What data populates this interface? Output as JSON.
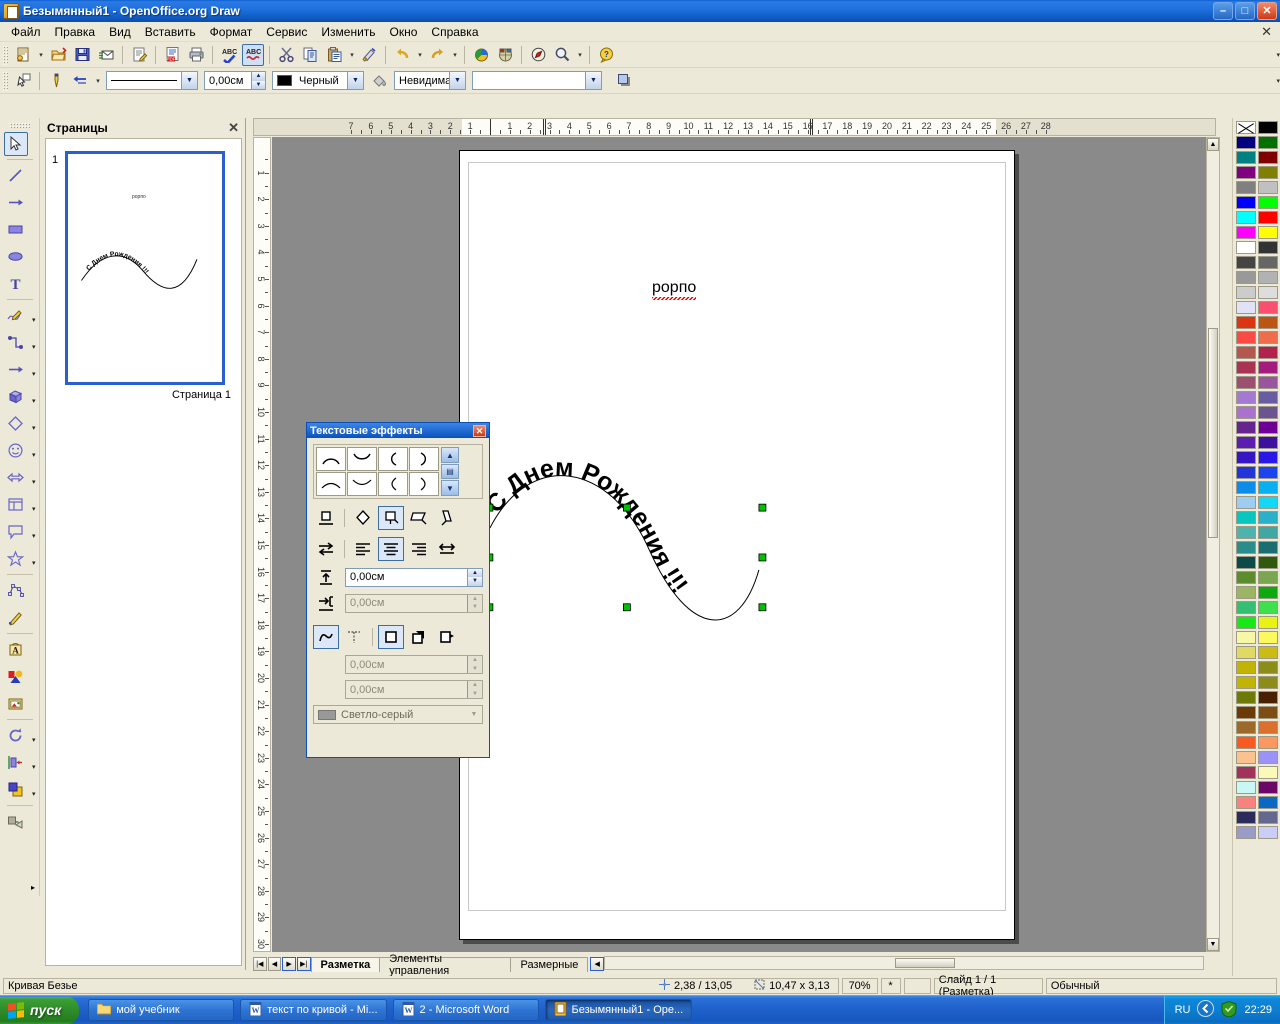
{
  "window": {
    "title": "Безымянный1 - OpenOffice.org Draw",
    "icon": "draw-app-icon",
    "minimize": "–",
    "maximize": "□",
    "close": "✕"
  },
  "menubar": {
    "items": [
      "Файл",
      "Правка",
      "Вид",
      "Вставить",
      "Формат",
      "Сервис",
      "Изменить",
      "Окно",
      "Справка"
    ],
    "doc_close": "✕"
  },
  "toolbar_standard": {
    "items": [
      {
        "name": "new-document-icon",
        "glyph": "📄",
        "dropdown": true
      },
      {
        "name": "open-document-icon",
        "glyph": "📂",
        "dropdown": false
      },
      {
        "name": "save-document-icon",
        "glyph": "💾",
        "dropdown": false
      },
      {
        "name": "send-email-icon",
        "glyph": "✉",
        "dropdown": false
      },
      {
        "name": "edit-file-icon",
        "glyph": "📝",
        "dropdown": false
      },
      {
        "name": "export-pdf-icon",
        "glyph": "📕",
        "dropdown": false
      },
      {
        "name": "print-icon",
        "glyph": "🖨",
        "dropdown": false
      },
      {
        "name": "spellcheck-icon",
        "glyph": "ABC✓",
        "dropdown": false
      },
      {
        "name": "autospellcheck-icon",
        "glyph": "ABC〰",
        "dropdown": false,
        "pressed": true
      },
      {
        "name": "cut-icon",
        "glyph": "✂",
        "dropdown": false
      },
      {
        "name": "copy-icon",
        "glyph": "⧉",
        "dropdown": false
      },
      {
        "name": "paste-icon",
        "glyph": "📋",
        "dropdown": true
      },
      {
        "name": "clone-formatting-icon",
        "glyph": "🖌",
        "dropdown": false
      },
      {
        "name": "undo-icon",
        "glyph": "↶",
        "dropdown": true
      },
      {
        "name": "redo-icon",
        "glyph": "↷",
        "dropdown": true
      },
      {
        "name": "chart-icon",
        "glyph": "◕",
        "dropdown": false
      },
      {
        "name": "gallery-icon",
        "glyph": "🖼",
        "dropdown": false
      },
      {
        "name": "navigator-icon",
        "glyph": "🧭",
        "dropdown": false
      },
      {
        "name": "zoom-icon",
        "glyph": "🔍",
        "dropdown": true
      },
      {
        "name": "help-icon",
        "glyph": "?",
        "dropdown": false
      }
    ],
    "overflow": "▾"
  },
  "toolbar_line_fill": {
    "pointer_icon": "select-pointer-icon",
    "pen_icon": "line-style-pen-icon",
    "arrow_icon": "arrow-style-icon",
    "line_style": {
      "value": "———————",
      "name": "line-style-combo"
    },
    "line_width": {
      "value": "0,00см",
      "name": "line-width-field"
    },
    "line_color": {
      "value": "Черный",
      "swatch": "#000000",
      "name": "line-color-combo"
    },
    "fill_bucket_icon": "fill-bucket-icon",
    "area_style": {
      "value": "Невидимая",
      "name": "area-style-combo"
    },
    "area_fill": {
      "value": "",
      "name": "area-fill-combo"
    },
    "shadow_icon": "shadow-icon",
    "overflow": "▾"
  },
  "left_toolbar": {
    "items": [
      {
        "name": "select-tool",
        "glyph": "select-arrow-icon",
        "selected": true,
        "dropdown": false
      },
      {
        "name": "line-tool",
        "glyph": "line-icon",
        "dropdown": false
      },
      {
        "name": "line-arrow-tool",
        "glyph": "arrow-line-icon",
        "dropdown": false
      },
      {
        "name": "rectangle-tool",
        "glyph": "rectangle-icon",
        "dropdown": false
      },
      {
        "name": "ellipse-tool",
        "glyph": "ellipse-icon",
        "dropdown": false
      },
      {
        "name": "text-tool",
        "glyph": "text-T-icon",
        "dropdown": false
      },
      {
        "name": "curve-tool",
        "glyph": "curve-pencil-icon",
        "dropdown": true
      },
      {
        "name": "connector-tool",
        "glyph": "connector-icon",
        "dropdown": true
      },
      {
        "name": "lines-and-arrows-tool",
        "glyph": "arrow-icon",
        "dropdown": true
      },
      {
        "name": "3d-objects-tool",
        "glyph": "cube-icon",
        "dropdown": true
      },
      {
        "name": "basic-shapes-tool",
        "glyph": "diamond-icon",
        "dropdown": true
      },
      {
        "name": "symbol-shapes-tool",
        "glyph": "smiley-icon",
        "dropdown": true
      },
      {
        "name": "block-arrows-tool",
        "glyph": "block-arrow-icon",
        "dropdown": true
      },
      {
        "name": "flowchart-tool",
        "glyph": "flowchart-icon",
        "dropdown": true
      },
      {
        "name": "callouts-tool",
        "glyph": "callout-icon",
        "dropdown": true
      },
      {
        "name": "stars-tool",
        "glyph": "star-icon",
        "dropdown": true
      },
      {
        "name": "points-tool",
        "glyph": "edit-points-icon",
        "dropdown": false
      },
      {
        "name": "glue-points-tool",
        "glyph": "glue-point-pen-icon",
        "dropdown": false
      },
      {
        "name": "fontwork-tool",
        "glyph": "fontwork-A-icon",
        "dropdown": false
      },
      {
        "name": "insert-image-tool",
        "glyph": "insert-image-icon",
        "dropdown": false
      },
      {
        "name": "gallery-tool",
        "glyph": "gallery-frame-icon",
        "dropdown": false
      },
      {
        "name": "rotate-tool",
        "glyph": "rotate-icon",
        "dropdown": true
      },
      {
        "name": "align-tool",
        "glyph": "align-left-icon",
        "dropdown": true
      },
      {
        "name": "arrange-tool",
        "glyph": "arrange-icon",
        "dropdown": true
      },
      {
        "name": "effects-tool",
        "glyph": "effects-icon",
        "dropdown": false
      }
    ],
    "overflow": "▸"
  },
  "pages_panel": {
    "title": "Страницы",
    "close": "✕",
    "page_number": "1",
    "caption": "Страница 1",
    "thumb_text_top": "рорпо",
    "thumb_text_curve": "С Днем Рождения !!!"
  },
  "rulers": {
    "horizontal_unit": "см",
    "h_left_labels": [
      "7",
      "6",
      "5",
      "4",
      "3",
      "2",
      "1"
    ],
    "h_right_labels": [
      "1",
      "2",
      "3",
      "4",
      "5",
      "6",
      "7",
      "8",
      "9",
      "10",
      "11",
      "12",
      "13",
      "14",
      "15",
      "16",
      "17",
      "18",
      "19",
      "20",
      "21",
      "22",
      "23",
      "24",
      "25",
      "26",
      "27",
      "28"
    ],
    "v_labels": [
      "1",
      "2",
      "3",
      "4",
      "5",
      "6",
      "7",
      "8",
      "9",
      "10",
      "11",
      "12",
      "13",
      "14",
      "15",
      "16",
      "17",
      "18",
      "19",
      "20",
      "21",
      "22",
      "23",
      "24",
      "25",
      "26",
      "27",
      "28",
      "29",
      "30"
    ]
  },
  "canvas": {
    "text_top": "рорпо",
    "text_curve": "С Днем Рождения !!!",
    "selection_handle_color": "#00c000",
    "object_type": "curved-text-on-bezier"
  },
  "text_effects_dialog": {
    "title": "Текстовые эффекты",
    "close": "✕",
    "shapes": [
      {
        "name": "arch-up-arc-shape",
        "glyph": "arc-up"
      },
      {
        "name": "arch-down-arc-shape",
        "glyph": "arc-down"
      },
      {
        "name": "arch-left-arc-shape",
        "glyph": "arc-left"
      },
      {
        "name": "arch-right-arc-shape",
        "glyph": "arc-right"
      },
      {
        "name": "arch-up-curve-shape",
        "glyph": "curve-up"
      },
      {
        "name": "arch-down-curve-shape",
        "glyph": "curve-down"
      },
      {
        "name": "arch-left-curve-shape",
        "glyph": "curve-left"
      },
      {
        "name": "arch-right-curve-shape",
        "glyph": "curve-right"
      }
    ],
    "scroll_up": "▲",
    "scroll_thumb": "▤",
    "scroll_down": "▼",
    "align_row": [
      {
        "name": "off-button",
        "glyph": "off"
      },
      {
        "name": "rotate-button",
        "glyph": "rotate"
      },
      {
        "name": "upright-button",
        "glyph": "upright",
        "selected": true
      },
      {
        "name": "slant-horizontal-button",
        "glyph": "slant-h"
      },
      {
        "name": "slant-vertical-button",
        "glyph": "slant-v"
      }
    ],
    "orient_row": [
      {
        "name": "orientation-button",
        "glyph": "orientation"
      },
      {
        "name": "align-left-button",
        "glyph": "align-left"
      },
      {
        "name": "align-center-button",
        "glyph": "align-center",
        "selected": true
      },
      {
        "name": "align-right-button",
        "glyph": "align-right"
      },
      {
        "name": "autofit-text-button",
        "glyph": "autofit"
      }
    ],
    "distance_label": "text-distance-icon",
    "distance_value": "0,00см",
    "indent_label": "text-indent-icon",
    "indent_value": "0,00см",
    "indent_disabled": true,
    "effect_row": [
      {
        "name": "contour-button",
        "glyph": "contour",
        "selected": true
      },
      {
        "name": "text-contour-button",
        "glyph": "text-contour"
      },
      {
        "name": "no-shadow-button",
        "glyph": "no-shadow",
        "selected": true
      },
      {
        "name": "normal-shadow-button",
        "glyph": "normal-shadow"
      },
      {
        "name": "slant-shadow-button",
        "glyph": "slant-shadow"
      }
    ],
    "shadow_x_value": "0,00см",
    "shadow_y_value": "0,00см",
    "shadow_disabled": true,
    "shadow_color": {
      "label": "Светло-серый",
      "swatch": "#999999"
    }
  },
  "layer_tabs": {
    "nav": [
      "|◀",
      "◀",
      "▶",
      "▶|"
    ],
    "tabs": [
      {
        "label": "Разметка",
        "active": true
      },
      {
        "label": "Элементы управления",
        "active": false
      },
      {
        "label": "Размерные",
        "active": false
      }
    ],
    "scroll_left": "◀"
  },
  "statusbar": {
    "object": "Кривая Безье",
    "position_icon": "cursor-position-icon",
    "position": "2,38 / 13,05",
    "size_icon": "object-size-icon",
    "size": "10,47 x 3,13",
    "zoom": "70%",
    "modified": "*",
    "signature": "",
    "slide": "Слайд 1 / 1 (Разметка)",
    "view": "Обычный"
  },
  "palette": {
    "colors": [
      [
        "none",
        "#000000"
      ],
      [
        "#000080",
        "#007000"
      ],
      [
        "#008080",
        "#800000"
      ],
      [
        "#800080",
        "#808000"
      ],
      [
        "#808080",
        "#c0c0c0"
      ],
      [
        "#0000ff",
        "#00ff00"
      ],
      [
        "#00ffff",
        "#ff0000"
      ],
      [
        "#ff00ff",
        "#ffff00"
      ],
      [
        "#ffffff",
        "#333333"
      ],
      [
        "#444444",
        "#666666"
      ],
      [
        "#999999",
        "#b2b2b2"
      ],
      [
        "#cccccc",
        "#dddddd"
      ],
      [
        "#dfe3f5",
        "#f9506f"
      ],
      [
        "#dc3512",
        "#bc5512"
      ],
      [
        "#f94b44",
        "#ef6d4d"
      ],
      [
        "#b4584f",
        "#b3214f"
      ],
      [
        "#a83352",
        "#a41c7d"
      ],
      [
        "#9c5070",
        "#9b55a0"
      ],
      [
        "#a37acf",
        "#6a5ca0"
      ],
      [
        "#aa72cc",
        "#6c5490"
      ],
      [
        "#66248e",
        "#6e0098"
      ],
      [
        "#5c1eb0",
        "#3e109e"
      ],
      [
        "#3716c4",
        "#2a18e8"
      ],
      [
        "#2334d8",
        "#1b44f0"
      ],
      [
        "#0a8ce8",
        "#09aff0"
      ],
      [
        "#9ecdf2",
        "#13d7f7"
      ],
      [
        "#07c6c0",
        "#2ab0c8"
      ],
      [
        "#4fb3ad",
        "#3fa8a5"
      ],
      [
        "#2b8c8c",
        "#1a6e72"
      ],
      [
        "#0c4a4a",
        "#2f5a0c"
      ],
      [
        "#5d8c2d",
        "#7aa652"
      ],
      [
        "#9cb562",
        "#0fa80f"
      ],
      [
        "#34c074",
        "#3ee04e"
      ],
      [
        "#19e818",
        "#e8f215"
      ],
      [
        "#f7f7a8",
        "#fbf95e"
      ],
      [
        "#e2d962",
        "#ccbb14"
      ],
      [
        "#c1b406",
        "#8c8c18"
      ],
      [
        "#c1b406",
        "#8c8c18"
      ],
      [
        "#6e7a07",
        "#4a2003"
      ],
      [
        "#6b3a06",
        "#7d4d14"
      ],
      [
        "#9b6a2a",
        "#d9702e"
      ],
      [
        "#f85a22",
        "#fb9860"
      ],
      [
        "#fbc18e",
        "#9a92f8"
      ],
      [
        "#a1325c",
        "#fbf9b8"
      ],
      [
        "#c9f7f5",
        "#6b0566"
      ],
      [
        "#f8827e",
        "#0a68c2"
      ],
      [
        "#2c2c5c",
        "#64688e"
      ],
      [
        "#9a9cc8",
        "#cacdf8"
      ]
    ]
  },
  "taskbar": {
    "start": "пуск",
    "tasks": [
      {
        "label": "мой учебник",
        "icon": "folder-icon",
        "active": false
      },
      {
        "label": "текст по кривой - Mi...",
        "icon": "word-doc-icon",
        "active": false
      },
      {
        "label": "2 - Microsoft Word",
        "icon": "word-doc-icon",
        "active": false
      },
      {
        "label": "Безымянный1 - Оре...",
        "icon": "draw-app-icon",
        "active": true
      }
    ],
    "tray": {
      "language": "RU",
      "icons": [
        "show-hidden-icon",
        "antivirus-shield-icon"
      ],
      "clock": "22:29"
    }
  }
}
